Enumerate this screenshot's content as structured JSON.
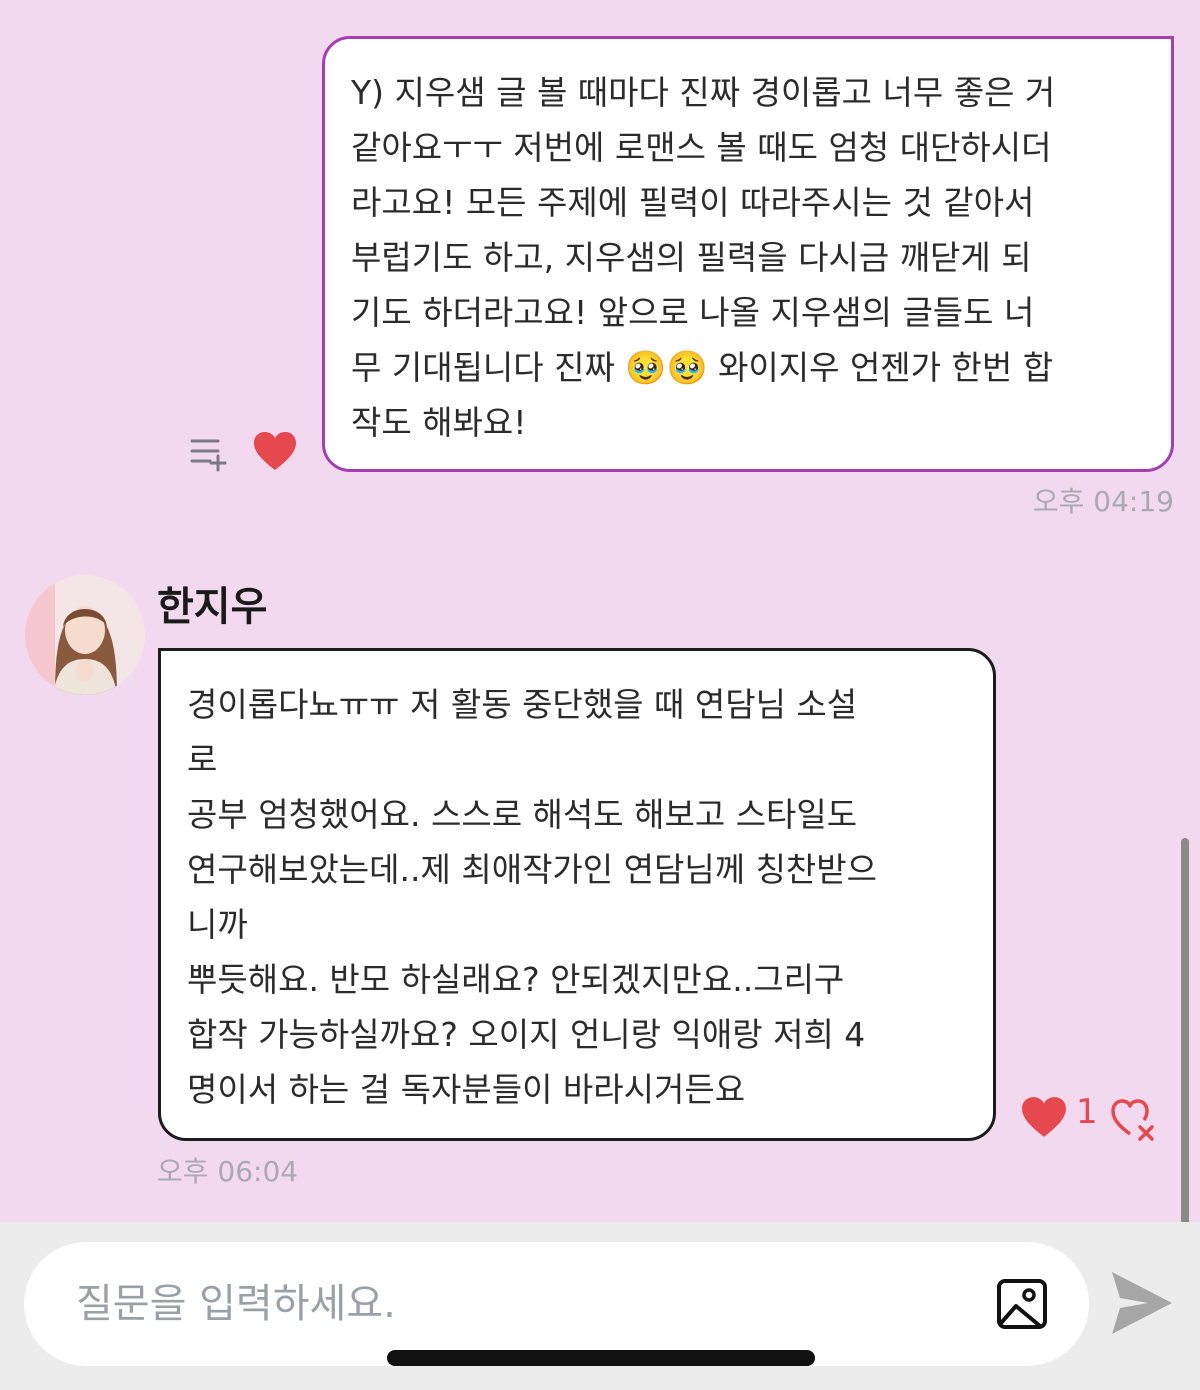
{
  "outgoing_message": {
    "text": "Y) 지우샘 글 볼 때마다 진짜 경이롭고 너무 좋은 거\n같아요ㅜㅜ 저번에 로맨스 볼 때도 엄청 대단하시더\n라고요! 모든 주제에 필력이 따라주시는 것 같아서\n부럽기도 하고, 지우샘의 필력을 다시금 깨닫게 되\n기도 하더라고요! 앞으로 나올 지우샘의 글들도 너\n무 기대됩니다 진짜 🥹🥹 와이지우 언젠가 한번 합\n작도 해봐요!",
    "time": "오후 04:19",
    "icons": [
      "memo-add-icon",
      "heart-icon"
    ]
  },
  "incoming_message": {
    "sender": "한지우",
    "text": "경이롭다뇨ㅠㅠ 저 활동 중단했을 때 연담님 소설\n로\n공부 엄청했어요. 스스로 해석도 해보고 스타일도\n연구해보았는데..제 최애작가인 연담님께 칭찬받으\n니까\n뿌듯해요. 반모 하실래요? 안되겠지만요..그리구\n합작 가능하실까요? 오이지 언니랑 익애랑 저희 4\n명이서 하는 걸 독자분들이 바라시거든요",
    "time": "오후 06:04",
    "like_count": "1",
    "icons": [
      "avatar",
      "heart-icon",
      "heart-add-icon"
    ]
  },
  "input": {
    "placeholder": "질문을 입력하세요.",
    "value": "",
    "icons": [
      "image-icon",
      "send-icon"
    ]
  },
  "colors": {
    "background": "#f3d9ef",
    "outgoing_border": "#a43fb0",
    "heart": "#e5484d",
    "input_area": "#ececec"
  }
}
